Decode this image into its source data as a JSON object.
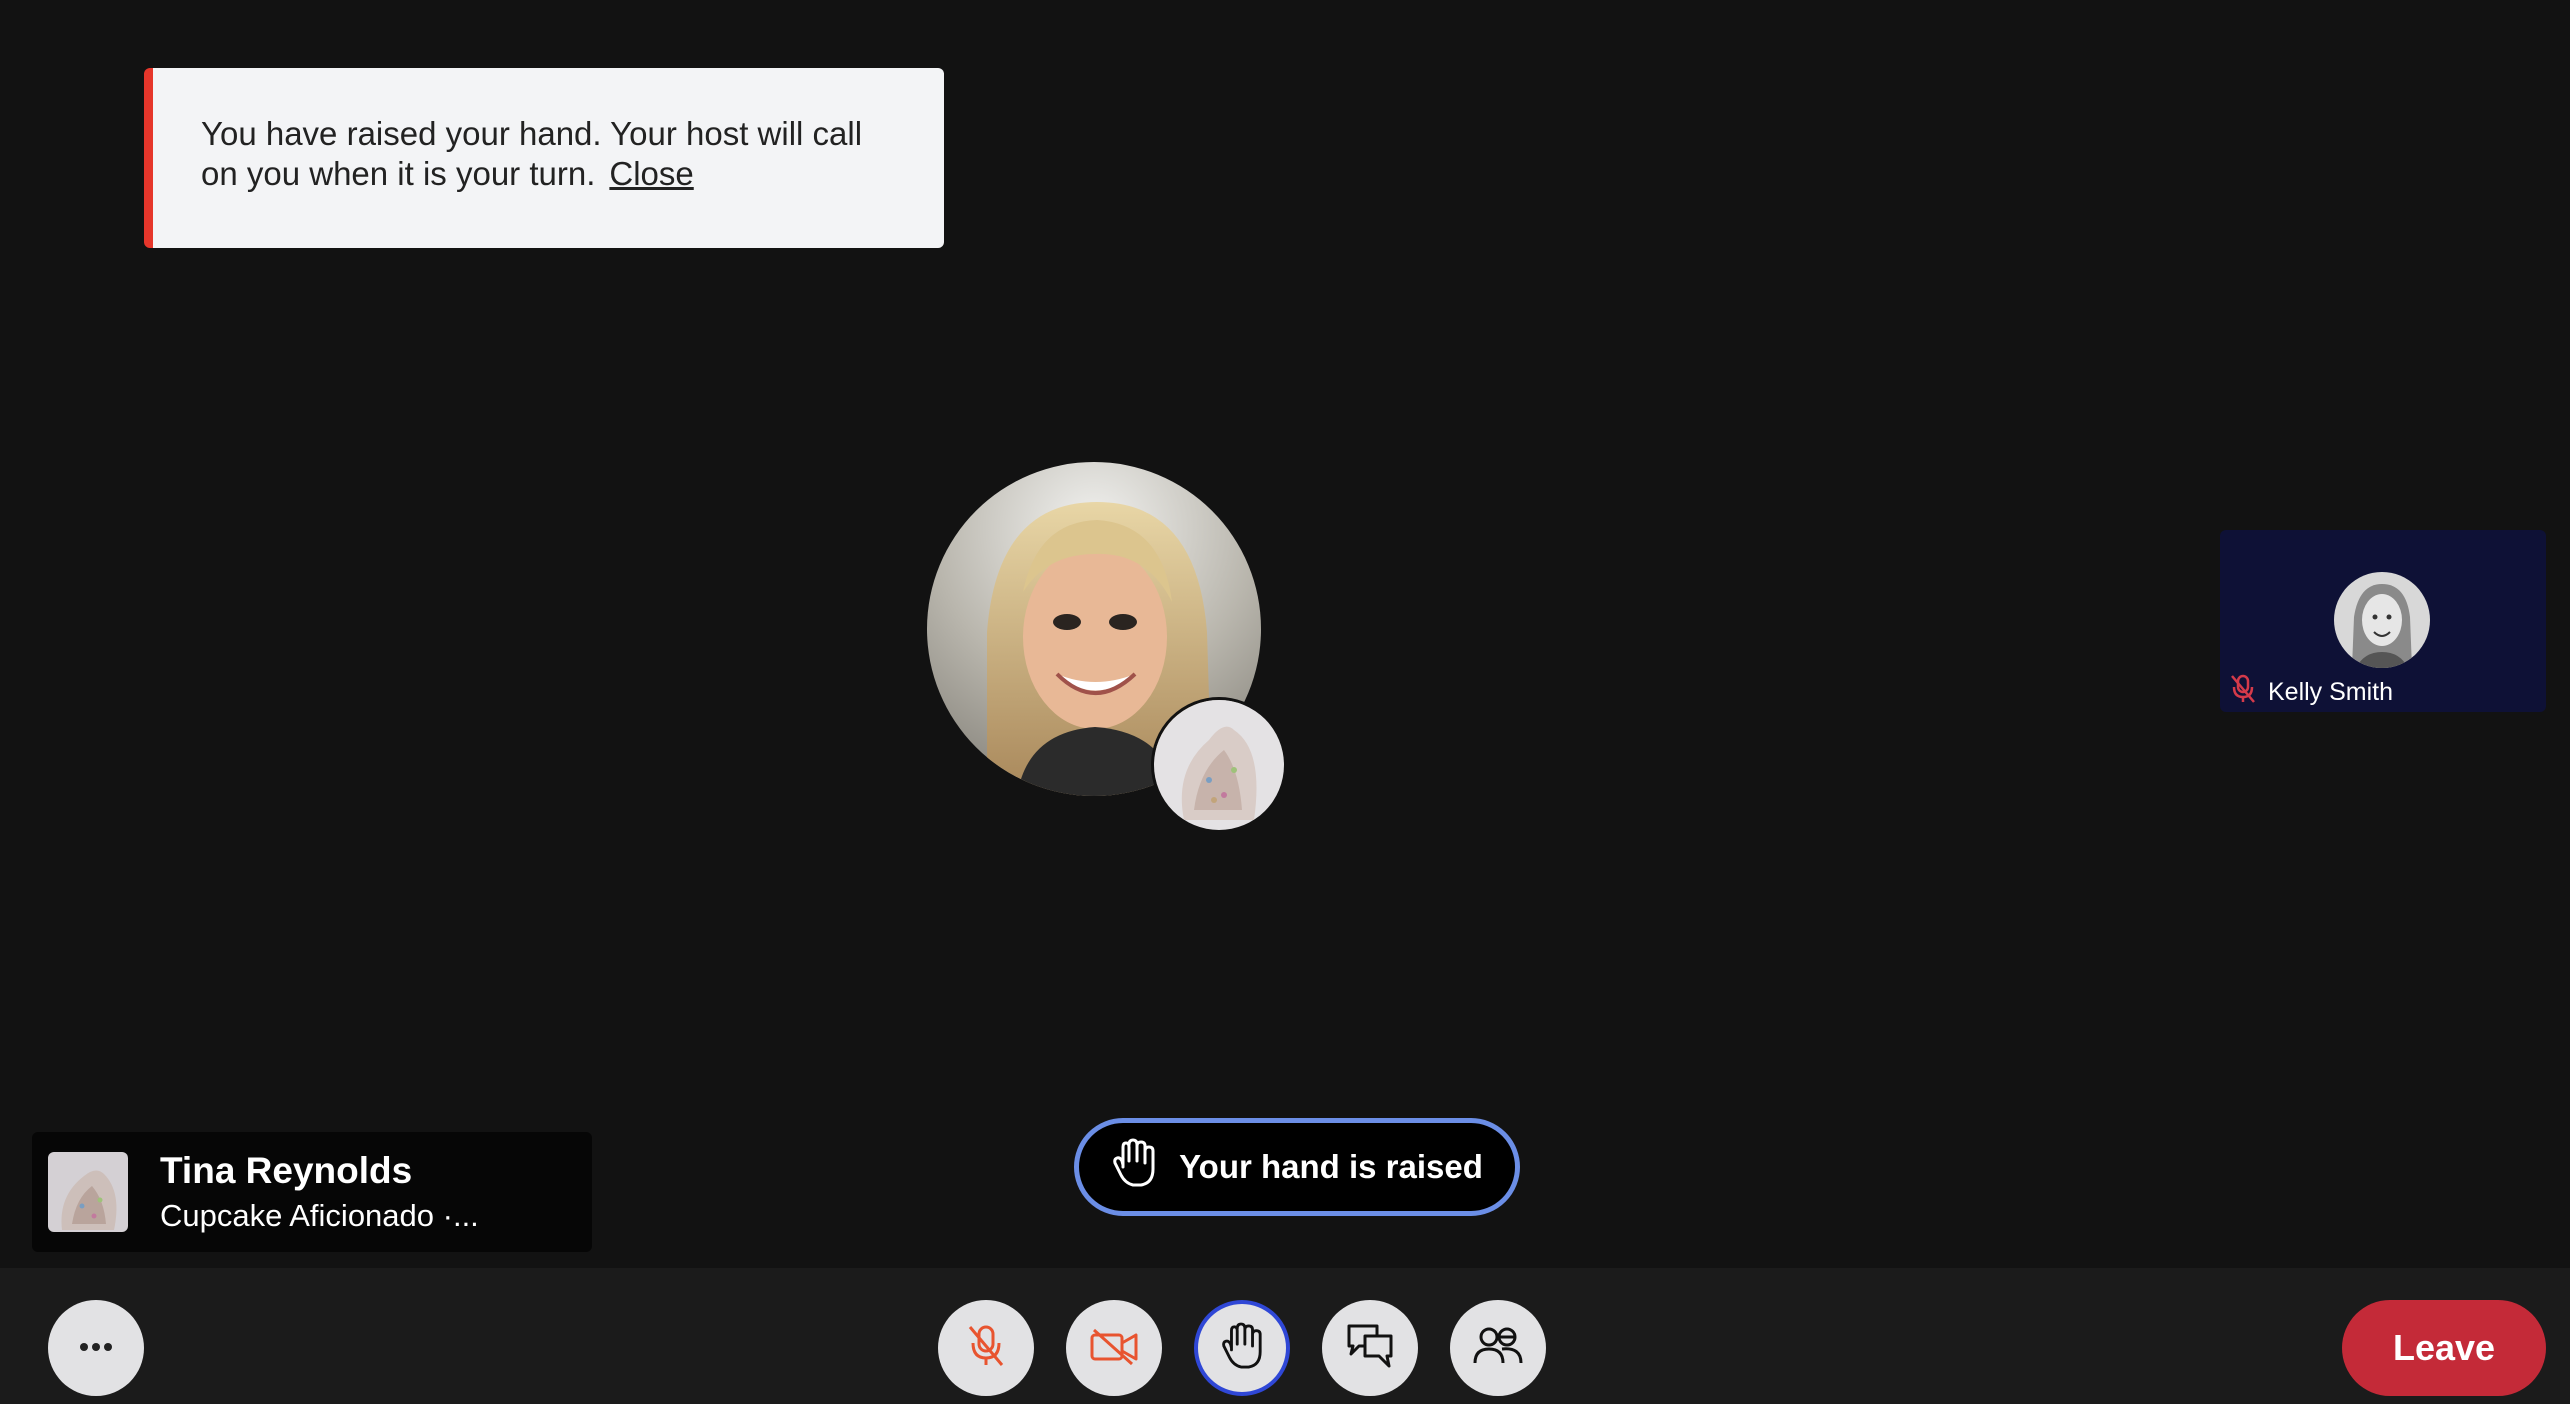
{
  "notice": {
    "message": "You have raised your hand. Your host will call on you when it is your turn.",
    "close_label": "Close",
    "accent_color": "#e6362b"
  },
  "main_participant": {
    "avatar_icon": "woman-portrait-avatar",
    "secondary_avatar_icon": "cupcake-avatar"
  },
  "participant_tile": {
    "name": "Kelly Smith",
    "muted_icon": "mic-off-icon"
  },
  "hand_raised_pill": {
    "label": "Your hand is raised",
    "icon": "raised-hand-icon",
    "border_color": "#6b8ee6"
  },
  "self_tile": {
    "name": "Tina Reynolds",
    "subtitle": "Cupcake Aficionado ·..."
  },
  "toolbar": {
    "more_icon": "more-options-icon",
    "mic_icon": "mic-off-icon",
    "camera_icon": "video-off-icon",
    "hand_icon": "raised-hand-icon",
    "chat_icon": "chat-icon",
    "people_icon": "people-icon",
    "leave_label": "Leave",
    "leave_color": "#c42a38",
    "active_ring_color": "#2f47d6"
  }
}
